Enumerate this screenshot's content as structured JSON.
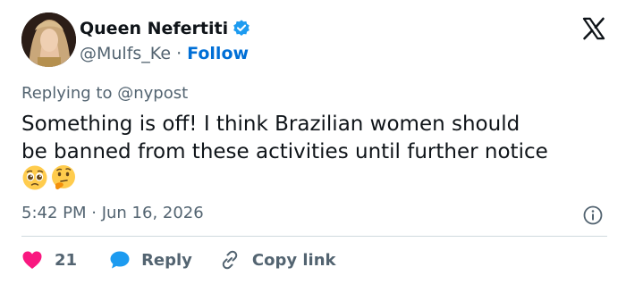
{
  "author": {
    "display_name": "Queen Nefertiti",
    "handle": "@Mulfs_Ke",
    "separator": "·",
    "follow_label": "Follow",
    "verified": true
  },
  "reply_context": {
    "prefix": "Replying to",
    "mention": "@nypost"
  },
  "tweet": {
    "text_line1": "Something is off! I think Brazilian women should",
    "text_line2": "be banned from these activities until further notice",
    "emojis": [
      "pleading-face",
      "thinking-face"
    ]
  },
  "meta": {
    "timestamp": "5:42 PM · Jun 16, 2026"
  },
  "actions": {
    "like_count": "21",
    "reply_label": "Reply",
    "copy_label": "Copy link"
  },
  "colors": {
    "text": "#0f1419",
    "secondary": "#536471",
    "link": "#006fd6",
    "like": "#f91880",
    "reply": "#1d9bf0",
    "verified": "#1d9bf0",
    "divider": "#cfd9de"
  }
}
